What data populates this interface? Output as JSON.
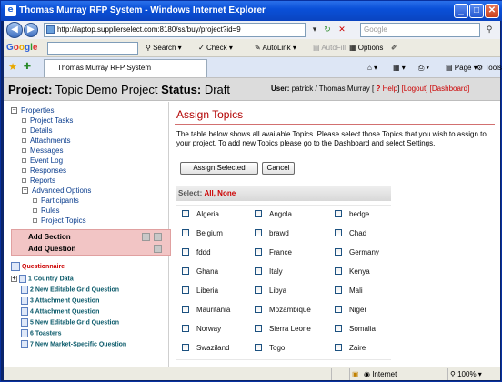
{
  "window": {
    "title": "Thomas Murray RFP System - Windows Internet Explorer",
    "app_icon": "ie-icon",
    "minimize": "_",
    "maximize": "□",
    "close": "✕"
  },
  "address_bar": {
    "url": "http://laptop.supplierselect.com:8180/ss/buy/project?id=9",
    "search_placeholder": "Google"
  },
  "google_toolbar": {
    "logo": "Google",
    "search_label": "Search",
    "check_label": "Check",
    "autolink_label": "AutoLink",
    "autofill_label": "AutoFill",
    "options_label": "Options"
  },
  "tab": {
    "label": "Thomas Murray RFP System"
  },
  "command_bar": {
    "page_label": "Page",
    "tools_label": "Tools"
  },
  "header": {
    "project_prefix": "Project:",
    "project_name": "Topic Demo Project",
    "status_prefix": "Status:",
    "status_value": "Draft",
    "user_prefix": "User:",
    "user_name": "patrick / Thomas Murray [",
    "help_q": "?",
    "help_label": "Help",
    "help_close": "]",
    "logout": "[Logout]",
    "dashboard": "[Dashboard]"
  },
  "sidebar": {
    "root": "Properties",
    "items": [
      {
        "label": "Project Tasks"
      },
      {
        "label": "Details"
      },
      {
        "label": "Attachments"
      },
      {
        "label": "Messages"
      },
      {
        "label": "Event Log"
      },
      {
        "label": "Responses"
      },
      {
        "label": "Reports"
      }
    ],
    "advanced": "Advanced Options",
    "advanced_items": [
      {
        "label": "Participants"
      },
      {
        "label": "Rules"
      },
      {
        "label": "Project Topics"
      }
    ],
    "add_section": "Add Section",
    "add_question": "Add Question",
    "questionnaire": "Questionnaire",
    "questions": [
      {
        "label": "1 Country Data"
      },
      {
        "label": "2 New Editable Grid Question"
      },
      {
        "label": "3 Attachment Question"
      },
      {
        "label": "4 Attachment Question"
      },
      {
        "label": "5 New Editable Grid Question"
      },
      {
        "label": "6 Toasters"
      },
      {
        "label": "7 New Market-Specific Question"
      }
    ]
  },
  "main": {
    "title": "Assign Topics",
    "description": "The table below shows all available Topics. Please select those Topics that you wish to assign to your project. To add new Topics please go to the Dashboard and select Settings.",
    "assign_button": "Assign Selected",
    "cancel_button": "Cancel",
    "select_label": "Select:",
    "select_all": "All",
    "select_sep": ",",
    "select_none": "None",
    "topics": [
      [
        "Algeria",
        "Angola",
        "bedge"
      ],
      [
        "Belgium",
        "brawd",
        "Chad"
      ],
      [
        "fddd",
        "France",
        "Germany"
      ],
      [
        "Ghana",
        "Italy",
        "Kenya"
      ],
      [
        "Liberia",
        "Libya",
        "Mali"
      ],
      [
        "Mauritania",
        "Mozambique",
        "Niger"
      ],
      [
        "Norway",
        "Sierra Leone",
        "Somalia"
      ],
      [
        "Swaziland",
        "Togo",
        "Zaire"
      ]
    ]
  },
  "status_bar": {
    "zone": "Internet",
    "zoom": "100%"
  }
}
